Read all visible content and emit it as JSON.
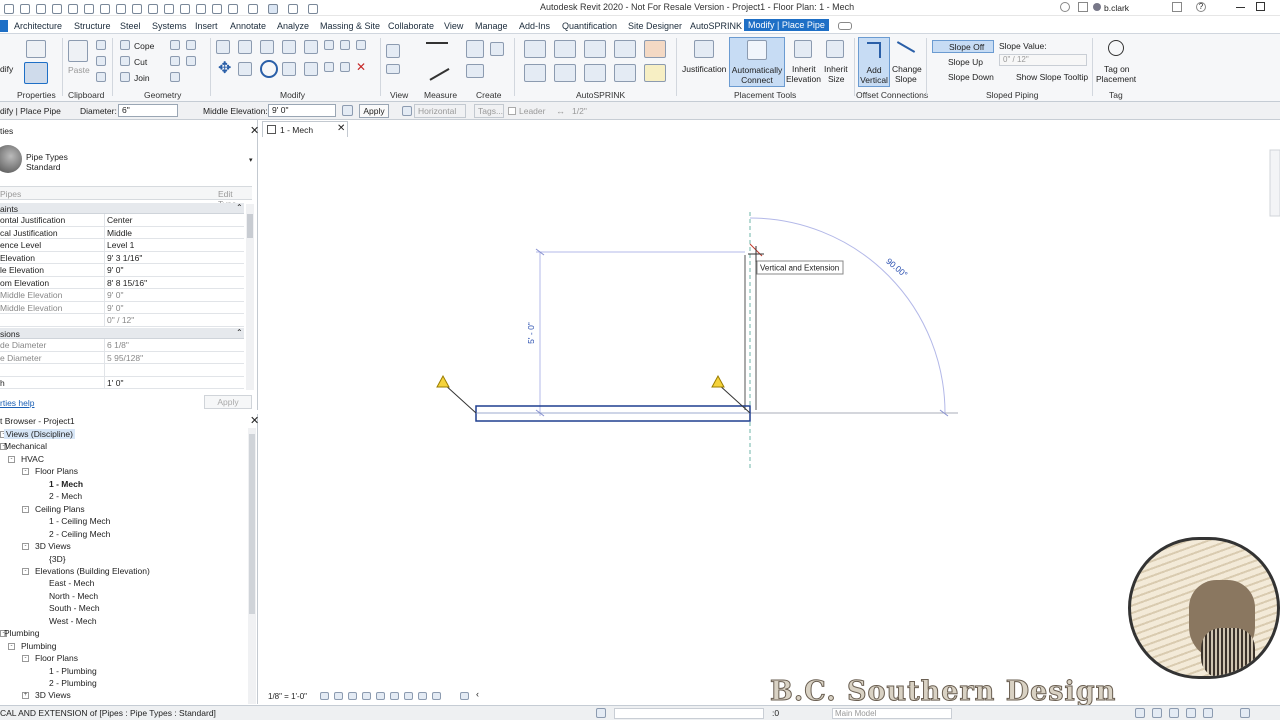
{
  "window": {
    "title": "Autodesk Revit 2020 - Not For Resale Version - Project1 - Floor Plan: 1 - Mech",
    "user": "b.clark"
  },
  "menu_tabs": [
    "Architecture",
    "Structure",
    "Steel",
    "Systems",
    "Insert",
    "Annotate",
    "Analyze",
    "Massing & Site",
    "Collaborate",
    "View",
    "Manage",
    "Add-Ins",
    "Quantification",
    "Site Designer",
    "AutoSPRINK",
    "Modify | Place Pipe"
  ],
  "ribbon": {
    "left_label": "dify",
    "panels": [
      "Properties",
      "Clipboard",
      "Geometry",
      "Modify",
      "View",
      "Measure",
      "Create",
      "AutoSPRINK",
      "Placement Tools",
      "Offset Connections",
      "Sloped Piping",
      "Tag"
    ],
    "cope": "Cope",
    "cut": "Cut",
    "join": "Join",
    "paste": "Paste",
    "justification": "Justification",
    "auto_connect": [
      "Automatically",
      "Connect"
    ],
    "inherit_elevation": [
      "Inherit",
      "Elevation"
    ],
    "inherit_size": [
      "Inherit",
      "Size"
    ],
    "add_vertical": [
      "Add",
      "Vertical"
    ],
    "change_slope": [
      "Change",
      "Slope"
    ],
    "slope_off": "Slope Off",
    "slope_up": "Slope Up",
    "slope_down": "Slope Down",
    "slope_value_label": "Slope Value:",
    "slope_value": "0\" / 12\"",
    "show_slope_tooltip": "Show Slope Tooltip",
    "tag_on_placement": [
      "Tag on",
      "Placement"
    ]
  },
  "options_bar": {
    "context": "dify | Place Pipe",
    "diameter_label": "Diameter:",
    "diameter": "6\"",
    "middle_elev_label": "Middle Elevation:",
    "middle_elev": "9' 0\"",
    "apply": "Apply",
    "horizontal": "Horizontal",
    "tags": "Tags...",
    "leader": "Leader",
    "leader_len": "1/2\""
  },
  "properties": {
    "title": "ties",
    "type_name": "Pipe Types",
    "type_value": "Standard",
    "filter": "Pipes",
    "edit_type": "Edit Type",
    "section1": "aints",
    "rows1": [
      {
        "k": "ontal Justification",
        "v": "Center",
        "grey": false
      },
      {
        "k": "cal Justification",
        "v": "Middle",
        "grey": false
      },
      {
        "k": "ence Level",
        "v": "Level 1",
        "grey": false
      },
      {
        "k": "Elevation",
        "v": "9' 3 1/16\"",
        "grey": false
      },
      {
        "k": "le Elevation",
        "v": "9' 0\"",
        "grey": false
      },
      {
        "k": "om Elevation",
        "v": "8' 8 15/16\"",
        "grey": false
      },
      {
        "k": "Middle Elevation",
        "v": "9' 0\"",
        "grey": true
      },
      {
        "k": "Middle Elevation",
        "v": "9' 0\"",
        "grey": true
      },
      {
        "k": "",
        "v": "0\" / 12\"",
        "grey": true
      }
    ],
    "section2": "sions",
    "rows2": [
      {
        "k": "de Diameter",
        "v": "6 1/8\"",
        "grey": true
      },
      {
        "k": "e Diameter",
        "v": "5 95/128\"",
        "grey": true
      },
      {
        "k": "",
        "v": "",
        "grey": false
      },
      {
        "k": "h",
        "v": "1' 0\"",
        "grey": false
      }
    ],
    "help": "rties help",
    "apply": "Apply"
  },
  "browser": {
    "title": "t Browser - Project1",
    "items": [
      {
        "t": "Views (Discipline)",
        "lvl": 0,
        "tog": "-",
        "sel": true,
        "bold": false
      },
      {
        "t": "Mechanical",
        "lvl": 0,
        "tog": "-",
        "sel": false,
        "bold": false
      },
      {
        "t": "HVAC",
        "lvl": 1,
        "tog": "-",
        "sel": false,
        "bold": false
      },
      {
        "t": "Floor Plans",
        "lvl": 2,
        "tog": "-",
        "sel": false,
        "bold": false
      },
      {
        "t": "1 - Mech",
        "lvl": 3,
        "tog": "",
        "sel": false,
        "bold": true
      },
      {
        "t": "2 - Mech",
        "lvl": 3,
        "tog": "",
        "sel": false,
        "bold": false
      },
      {
        "t": "Ceiling Plans",
        "lvl": 2,
        "tog": "-",
        "sel": false,
        "bold": false
      },
      {
        "t": "1 - Ceiling Mech",
        "lvl": 3,
        "tog": "",
        "sel": false,
        "bold": false
      },
      {
        "t": "2 - Ceiling Mech",
        "lvl": 3,
        "tog": "",
        "sel": false,
        "bold": false
      },
      {
        "t": "3D Views",
        "lvl": 2,
        "tog": "-",
        "sel": false,
        "bold": false
      },
      {
        "t": "{3D}",
        "lvl": 3,
        "tog": "",
        "sel": false,
        "bold": false
      },
      {
        "t": "Elevations (Building Elevation)",
        "lvl": 2,
        "tog": "-",
        "sel": false,
        "bold": false
      },
      {
        "t": "East - Mech",
        "lvl": 3,
        "tog": "",
        "sel": false,
        "bold": false
      },
      {
        "t": "North - Mech",
        "lvl": 3,
        "tog": "",
        "sel": false,
        "bold": false
      },
      {
        "t": "South - Mech",
        "lvl": 3,
        "tog": "",
        "sel": false,
        "bold": false
      },
      {
        "t": "West - Mech",
        "lvl": 3,
        "tog": "",
        "sel": false,
        "bold": false
      },
      {
        "t": "Plumbing",
        "lvl": 0,
        "tog": "-",
        "sel": false,
        "bold": false
      },
      {
        "t": "Plumbing",
        "lvl": 1,
        "tog": "-",
        "sel": false,
        "bold": false
      },
      {
        "t": "Floor Plans",
        "lvl": 2,
        "tog": "-",
        "sel": false,
        "bold": false
      },
      {
        "t": "1 - Plumbing",
        "lvl": 3,
        "tog": "",
        "sel": false,
        "bold": false
      },
      {
        "t": "2 - Plumbing",
        "lvl": 3,
        "tog": "",
        "sel": false,
        "bold": false
      },
      {
        "t": "3D Views",
        "lvl": 2,
        "tog": "+",
        "sel": false,
        "bold": false
      }
    ]
  },
  "view": {
    "tab": "1 - Mech",
    "scale": "1/8\" = 1'-0\"",
    "tooltip": "Vertical and Extension",
    "dim_vertical": "5' - 0\"",
    "angle": "90.00°"
  },
  "status": {
    "text": "CAL AND EXTENSION  of [Pipes : Pipe Types : Standard]",
    "workset": ":0",
    "model": "Main Model"
  },
  "watermark": "B.C. Southern Design"
}
